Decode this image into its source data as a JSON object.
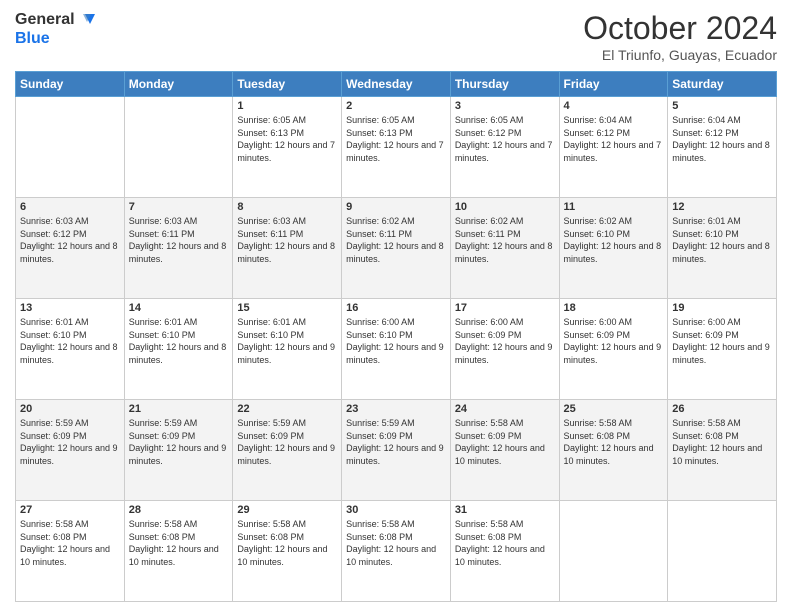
{
  "header": {
    "logo_line1": "General",
    "logo_line2": "Blue",
    "month": "October 2024",
    "location": "El Triunfo, Guayas, Ecuador"
  },
  "days_of_week": [
    "Sunday",
    "Monday",
    "Tuesday",
    "Wednesday",
    "Thursday",
    "Friday",
    "Saturday"
  ],
  "weeks": [
    [
      {
        "day": "",
        "sunrise": "",
        "sunset": "",
        "daylight": ""
      },
      {
        "day": "",
        "sunrise": "",
        "sunset": "",
        "daylight": ""
      },
      {
        "day": "1",
        "sunrise": "Sunrise: 6:05 AM",
        "sunset": "Sunset: 6:13 PM",
        "daylight": "Daylight: 12 hours and 7 minutes."
      },
      {
        "day": "2",
        "sunrise": "Sunrise: 6:05 AM",
        "sunset": "Sunset: 6:13 PM",
        "daylight": "Daylight: 12 hours and 7 minutes."
      },
      {
        "day": "3",
        "sunrise": "Sunrise: 6:05 AM",
        "sunset": "Sunset: 6:12 PM",
        "daylight": "Daylight: 12 hours and 7 minutes."
      },
      {
        "day": "4",
        "sunrise": "Sunrise: 6:04 AM",
        "sunset": "Sunset: 6:12 PM",
        "daylight": "Daylight: 12 hours and 7 minutes."
      },
      {
        "day": "5",
        "sunrise": "Sunrise: 6:04 AM",
        "sunset": "Sunset: 6:12 PM",
        "daylight": "Daylight: 12 hours and 8 minutes."
      }
    ],
    [
      {
        "day": "6",
        "sunrise": "Sunrise: 6:03 AM",
        "sunset": "Sunset: 6:12 PM",
        "daylight": "Daylight: 12 hours and 8 minutes."
      },
      {
        "day": "7",
        "sunrise": "Sunrise: 6:03 AM",
        "sunset": "Sunset: 6:11 PM",
        "daylight": "Daylight: 12 hours and 8 minutes."
      },
      {
        "day": "8",
        "sunrise": "Sunrise: 6:03 AM",
        "sunset": "Sunset: 6:11 PM",
        "daylight": "Daylight: 12 hours and 8 minutes."
      },
      {
        "day": "9",
        "sunrise": "Sunrise: 6:02 AM",
        "sunset": "Sunset: 6:11 PM",
        "daylight": "Daylight: 12 hours and 8 minutes."
      },
      {
        "day": "10",
        "sunrise": "Sunrise: 6:02 AM",
        "sunset": "Sunset: 6:11 PM",
        "daylight": "Daylight: 12 hours and 8 minutes."
      },
      {
        "day": "11",
        "sunrise": "Sunrise: 6:02 AM",
        "sunset": "Sunset: 6:10 PM",
        "daylight": "Daylight: 12 hours and 8 minutes."
      },
      {
        "day": "12",
        "sunrise": "Sunrise: 6:01 AM",
        "sunset": "Sunset: 6:10 PM",
        "daylight": "Daylight: 12 hours and 8 minutes."
      }
    ],
    [
      {
        "day": "13",
        "sunrise": "Sunrise: 6:01 AM",
        "sunset": "Sunset: 6:10 PM",
        "daylight": "Daylight: 12 hours and 8 minutes."
      },
      {
        "day": "14",
        "sunrise": "Sunrise: 6:01 AM",
        "sunset": "Sunset: 6:10 PM",
        "daylight": "Daylight: 12 hours and 8 minutes."
      },
      {
        "day": "15",
        "sunrise": "Sunrise: 6:01 AM",
        "sunset": "Sunset: 6:10 PM",
        "daylight": "Daylight: 12 hours and 9 minutes."
      },
      {
        "day": "16",
        "sunrise": "Sunrise: 6:00 AM",
        "sunset": "Sunset: 6:10 PM",
        "daylight": "Daylight: 12 hours and 9 minutes."
      },
      {
        "day": "17",
        "sunrise": "Sunrise: 6:00 AM",
        "sunset": "Sunset: 6:09 PM",
        "daylight": "Daylight: 12 hours and 9 minutes."
      },
      {
        "day": "18",
        "sunrise": "Sunrise: 6:00 AM",
        "sunset": "Sunset: 6:09 PM",
        "daylight": "Daylight: 12 hours and 9 minutes."
      },
      {
        "day": "19",
        "sunrise": "Sunrise: 6:00 AM",
        "sunset": "Sunset: 6:09 PM",
        "daylight": "Daylight: 12 hours and 9 minutes."
      }
    ],
    [
      {
        "day": "20",
        "sunrise": "Sunrise: 5:59 AM",
        "sunset": "Sunset: 6:09 PM",
        "daylight": "Daylight: 12 hours and 9 minutes."
      },
      {
        "day": "21",
        "sunrise": "Sunrise: 5:59 AM",
        "sunset": "Sunset: 6:09 PM",
        "daylight": "Daylight: 12 hours and 9 minutes."
      },
      {
        "day": "22",
        "sunrise": "Sunrise: 5:59 AM",
        "sunset": "Sunset: 6:09 PM",
        "daylight": "Daylight: 12 hours and 9 minutes."
      },
      {
        "day": "23",
        "sunrise": "Sunrise: 5:59 AM",
        "sunset": "Sunset: 6:09 PM",
        "daylight": "Daylight: 12 hours and 9 minutes."
      },
      {
        "day": "24",
        "sunrise": "Sunrise: 5:58 AM",
        "sunset": "Sunset: 6:09 PM",
        "daylight": "Daylight: 12 hours and 10 minutes."
      },
      {
        "day": "25",
        "sunrise": "Sunrise: 5:58 AM",
        "sunset": "Sunset: 6:08 PM",
        "daylight": "Daylight: 12 hours and 10 minutes."
      },
      {
        "day": "26",
        "sunrise": "Sunrise: 5:58 AM",
        "sunset": "Sunset: 6:08 PM",
        "daylight": "Daylight: 12 hours and 10 minutes."
      }
    ],
    [
      {
        "day": "27",
        "sunrise": "Sunrise: 5:58 AM",
        "sunset": "Sunset: 6:08 PM",
        "daylight": "Daylight: 12 hours and 10 minutes."
      },
      {
        "day": "28",
        "sunrise": "Sunrise: 5:58 AM",
        "sunset": "Sunset: 6:08 PM",
        "daylight": "Daylight: 12 hours and 10 minutes."
      },
      {
        "day": "29",
        "sunrise": "Sunrise: 5:58 AM",
        "sunset": "Sunset: 6:08 PM",
        "daylight": "Daylight: 12 hours and 10 minutes."
      },
      {
        "day": "30",
        "sunrise": "Sunrise: 5:58 AM",
        "sunset": "Sunset: 6:08 PM",
        "daylight": "Daylight: 12 hours and 10 minutes."
      },
      {
        "day": "31",
        "sunrise": "Sunrise: 5:58 AM",
        "sunset": "Sunset: 6:08 PM",
        "daylight": "Daylight: 12 hours and 10 minutes."
      },
      {
        "day": "",
        "sunrise": "",
        "sunset": "",
        "daylight": ""
      },
      {
        "day": "",
        "sunrise": "",
        "sunset": "",
        "daylight": ""
      }
    ]
  ]
}
